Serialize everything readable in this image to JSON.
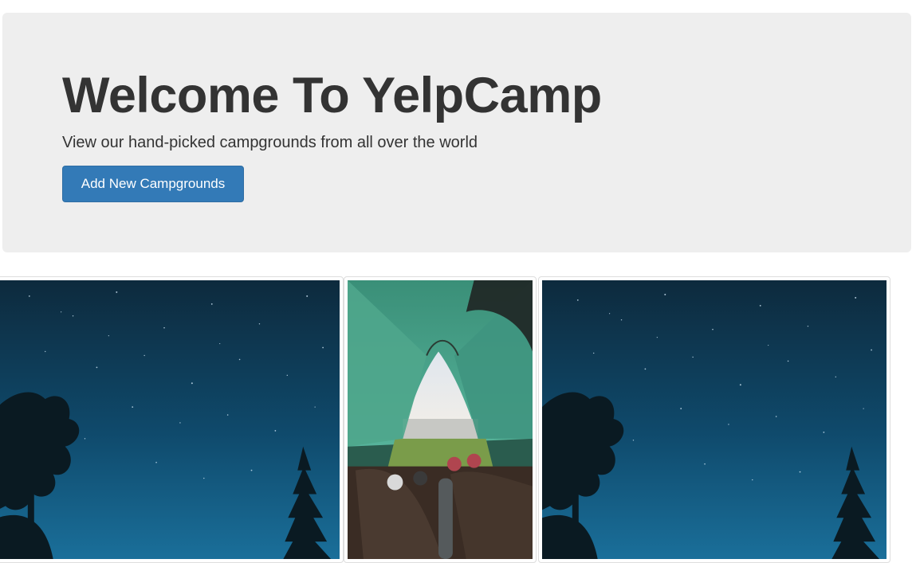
{
  "jumbotron": {
    "title": "Welcome To YelpCamp",
    "lead": "View our hand-picked campgrounds from all over the world",
    "add_button_label": "Add New Campgrounds"
  },
  "campgrounds": [
    {
      "image": "night-sky-trees-image"
    },
    {
      "image": "tent-view-image"
    },
    {
      "image": "night-sky-trees-image"
    }
  ],
  "colors": {
    "jumbotron_bg": "#eeeeee",
    "primary": "#337ab7",
    "text": "#333333"
  }
}
